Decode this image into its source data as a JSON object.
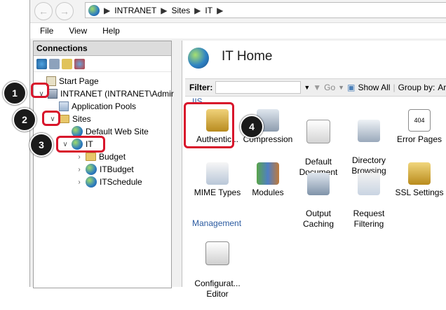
{
  "address": {
    "crumbs": [
      "INTRANET",
      "Sites",
      "IT"
    ]
  },
  "menu": [
    "File",
    "View",
    "Help"
  ],
  "connections": {
    "title": "Connections",
    "tree": [
      {
        "label": "Start Page",
        "icon": "start-page-icon"
      },
      {
        "label": "INTRANET (INTRANET\\Admir",
        "icon": "server-icon"
      },
      {
        "label": "Application Pools",
        "icon": "app-pools-icon"
      },
      {
        "label": "Sites",
        "icon": "sites-icon"
      },
      {
        "label": "Default Web Site",
        "icon": "globe-icon"
      },
      {
        "label": "IT",
        "icon": "globe-icon"
      },
      {
        "label": "Budget",
        "icon": "folder-icon"
      },
      {
        "label": "ITBudget",
        "icon": "globe-icon"
      },
      {
        "label": "ITSchedule",
        "icon": "globe-icon"
      }
    ]
  },
  "main": {
    "title": "IT Home",
    "filter": {
      "label": "Filter:",
      "go": "Go",
      "show_all": "Show All",
      "group_by": "Group by:",
      "group_value": "Ar"
    },
    "sections": {
      "iis": "IIS",
      "management": "Management"
    },
    "features": [
      {
        "label": "Authentic...",
        "icon": "authentication-icon"
      },
      {
        "label": "Compression",
        "icon": "compression-icon"
      },
      {
        "label": "Default\nDocument",
        "icon": "default-document-icon"
      },
      {
        "label": "Directory\nBrowsing",
        "icon": "directory-browsing-icon"
      },
      {
        "label": "Error Pages",
        "icon": "error-pages-icon",
        "badge_text": "404"
      },
      {
        "label": "MIME Types",
        "icon": "mime-types-icon"
      },
      {
        "label": "Modules",
        "icon": "modules-icon"
      },
      {
        "label": "Output\nCaching",
        "icon": "output-caching-icon"
      },
      {
        "label": "Request\nFiltering",
        "icon": "request-filtering-icon"
      },
      {
        "label": "SSL Settings",
        "icon": "ssl-settings-icon"
      },
      {
        "label": "Configurat...\nEditor",
        "icon": "configuration-editor-icon"
      }
    ]
  },
  "callouts": [
    "1",
    "2",
    "3",
    "4"
  ],
  "colors": {
    "highlight": "#d8152b",
    "badge": "#1a1a1a",
    "section": "#2a5aa0"
  }
}
